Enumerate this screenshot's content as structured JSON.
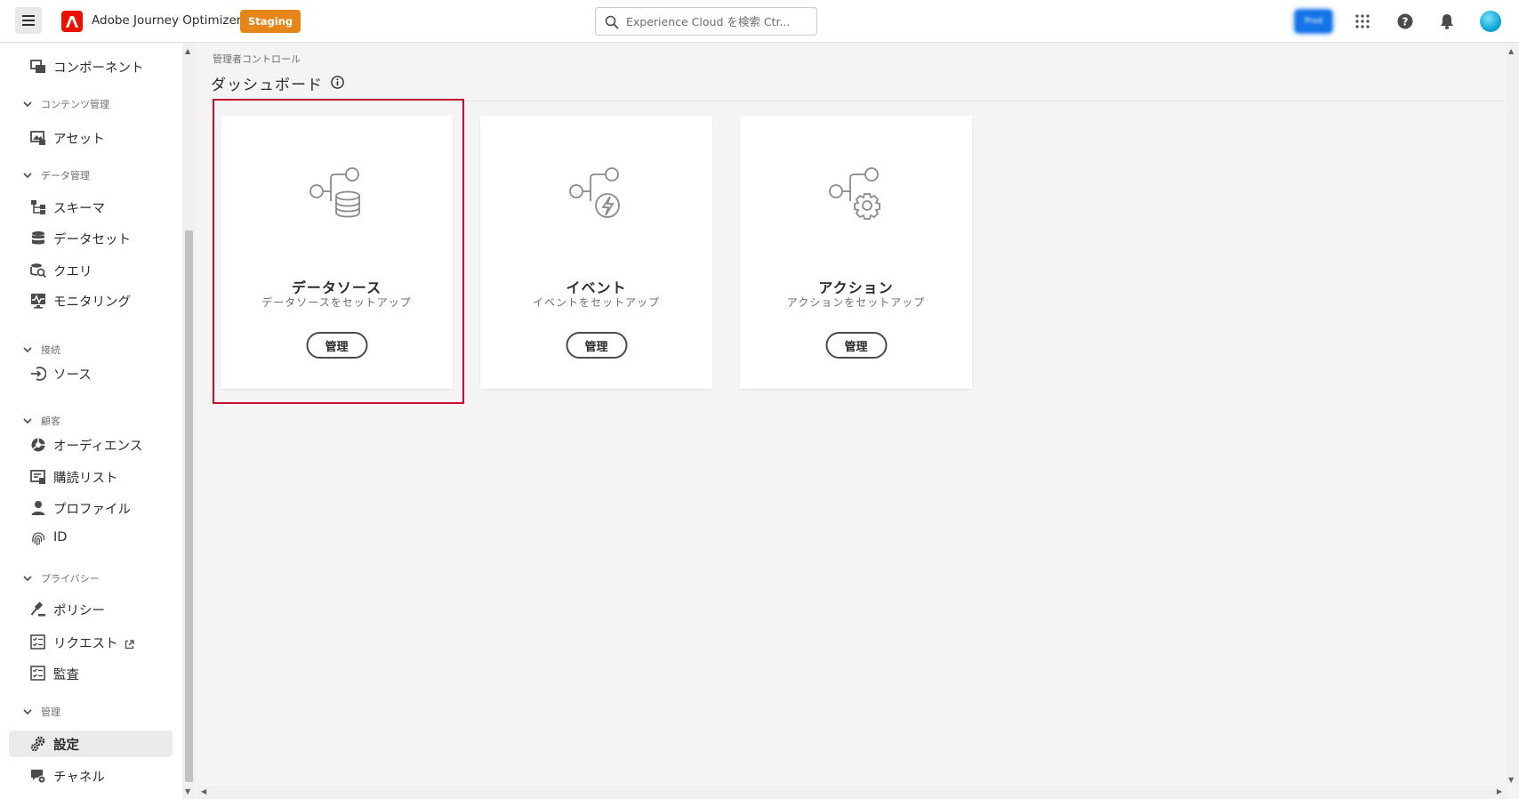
{
  "header": {
    "app_title": "Adobe Journey Optimizer",
    "environment_badge": "Staging",
    "search_placeholder": "Experience Cloud を検索 Ctr...",
    "org_label": "Prod"
  },
  "sidebar": {
    "items": [
      {
        "type": "item",
        "label": "コンポーネント",
        "icon": "components-icon"
      },
      {
        "type": "section",
        "label": "コンテンツ管理"
      },
      {
        "type": "item",
        "label": "アセット",
        "icon": "assets-icon"
      },
      {
        "type": "section",
        "label": "データ管理"
      },
      {
        "type": "item",
        "label": "スキーマ",
        "icon": "schema-icon"
      },
      {
        "type": "item",
        "label": "データセット",
        "icon": "dataset-icon"
      },
      {
        "type": "item",
        "label": "クエリ",
        "icon": "query-icon"
      },
      {
        "type": "item",
        "label": "モニタリング",
        "icon": "monitoring-icon"
      },
      {
        "type": "section",
        "label": "接続"
      },
      {
        "type": "item",
        "label": "ソース",
        "icon": "sources-icon"
      },
      {
        "type": "section",
        "label": "顧客"
      },
      {
        "type": "item",
        "label": "オーディエンス",
        "icon": "audiences-icon"
      },
      {
        "type": "item",
        "label": "購読リスト",
        "icon": "subscription-list-icon"
      },
      {
        "type": "item",
        "label": "プロファイル",
        "icon": "profile-icon"
      },
      {
        "type": "item",
        "label": "ID",
        "icon": "fingerprint-icon"
      },
      {
        "type": "section",
        "label": "プライバシー"
      },
      {
        "type": "item",
        "label": "ポリシー",
        "icon": "gavel-icon"
      },
      {
        "type": "item",
        "label": "リクエスト",
        "icon": "checklist-icon",
        "external": true
      },
      {
        "type": "item",
        "label": "監査",
        "icon": "checklist-icon"
      },
      {
        "type": "section",
        "label": "管理"
      },
      {
        "type": "item",
        "label": "設定",
        "icon": "gears-icon",
        "active": true
      },
      {
        "type": "item",
        "label": "チャネル",
        "icon": "channels-icon"
      }
    ]
  },
  "main": {
    "breadcrumb": "管理者コントロール",
    "title": "ダッシュボード",
    "cards": [
      {
        "title": "データソース",
        "subtitle": "データソースをセットアップ",
        "button": "管理",
        "icon": "data-source-icon",
        "highlighted": true
      },
      {
        "title": "イベント",
        "subtitle": "イベントをセットアップ",
        "button": "管理",
        "icon": "event-icon"
      },
      {
        "title": "アクション",
        "subtitle": "アクションをセットアップ",
        "button": "管理",
        "icon": "action-icon"
      }
    ]
  },
  "colors": {
    "accent": "#1473e6",
    "badge": "#e68619",
    "adobe_red": "#eb1000",
    "highlight": "#c8102e"
  }
}
